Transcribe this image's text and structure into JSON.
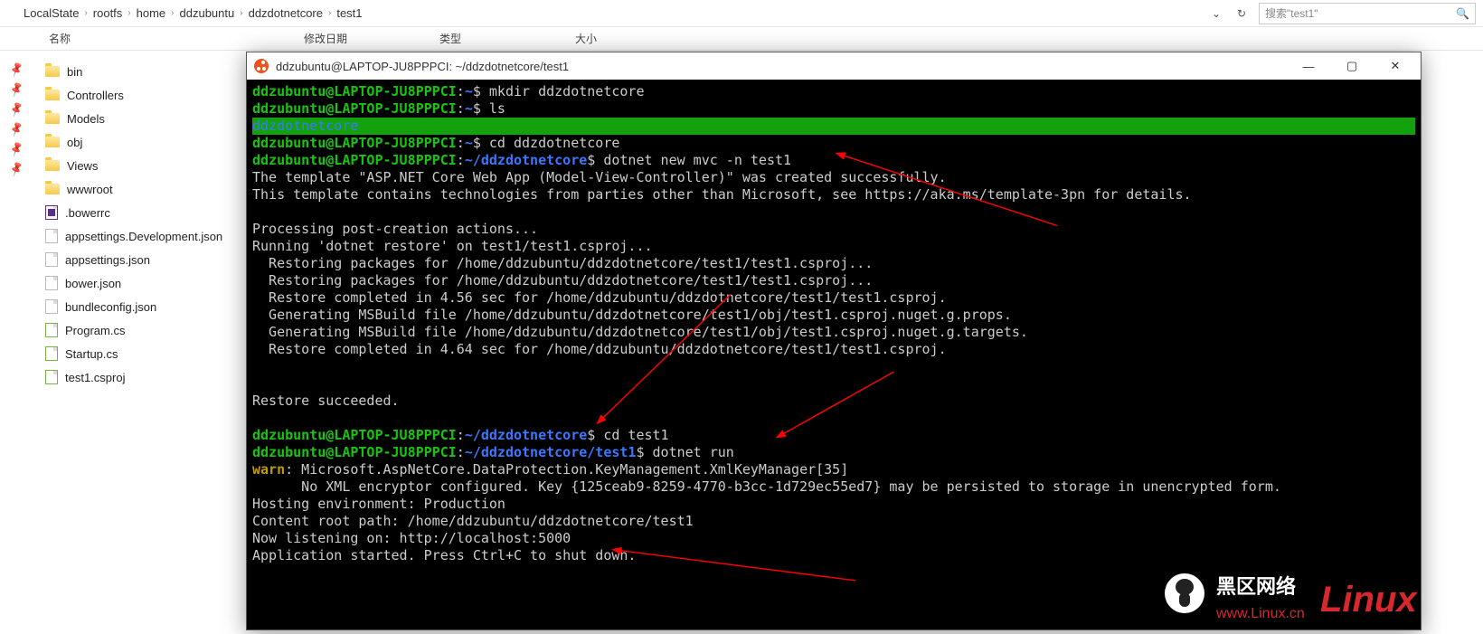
{
  "breadcrumb": [
    "LocalState",
    "rootfs",
    "home",
    "ddzubuntu",
    "ddzdotnetcore",
    "test1"
  ],
  "search_placeholder": "搜索\"test1\"",
  "columns": {
    "name": "名称",
    "mod": "修改日期",
    "type": "类型",
    "size": "大小"
  },
  "files": [
    {
      "name": "bin",
      "type": "folder"
    },
    {
      "name": "Controllers",
      "type": "folder"
    },
    {
      "name": "Models",
      "type": "folder"
    },
    {
      "name": "obj",
      "type": "folder"
    },
    {
      "name": "Views",
      "type": "folder"
    },
    {
      "name": "wwwroot",
      "type": "folder"
    },
    {
      "name": ".bowerrc",
      "type": "vs"
    },
    {
      "name": "appsettings.Development.json",
      "type": "file"
    },
    {
      "name": "appsettings.json",
      "type": "file"
    },
    {
      "name": "bower.json",
      "type": "file"
    },
    {
      "name": "bundleconfig.json",
      "type": "file"
    },
    {
      "name": "Program.cs",
      "type": "prog"
    },
    {
      "name": "Startup.cs",
      "type": "prog"
    },
    {
      "name": "test1.csproj",
      "type": "prog"
    }
  ],
  "pin_count": 6,
  "terminal": {
    "title": "ddzubuntu@LAPTOP-JU8PPPCI: ~/ddzdotnetcore/test1",
    "prompt_user": "ddzubuntu@LAPTOP-JU8PPPCI",
    "home_tilde": "~",
    "dir1": "~/ddzdotnetcore",
    "dir2": "~/ddzdotnetcore/test1",
    "cmd_mkdir": "mkdir ddzdotnetcore",
    "cmd_ls": "ls",
    "ls_out": "ddzdotnetcore",
    "cmd_cd1": "cd ddzdotnetcore",
    "cmd_new": "dotnet new mvc -n test1",
    "out_template": "The template \"ASP.NET Core Web App (Model-View-Controller)\" was created successfully.",
    "out_parties": "This template contains technologies from parties other than Microsoft, see https://aka.ms/template-3pn for details.",
    "out_post": "Processing post-creation actions...",
    "out_restore": "Running 'dotnet restore' on test1/test1.csproj...",
    "out_r1": "  Restoring packages for /home/ddzubuntu/ddzdotnetcore/test1/test1.csproj...",
    "out_r2": "  Restoring packages for /home/ddzubuntu/ddzdotnetcore/test1/test1.csproj...",
    "out_r3": "  Restore completed in 4.56 sec for /home/ddzubuntu/ddzdotnetcore/test1/test1.csproj.",
    "out_r4": "  Generating MSBuild file /home/ddzubuntu/ddzdotnetcore/test1/obj/test1.csproj.nuget.g.props.",
    "out_r5": "  Generating MSBuild file /home/ddzubuntu/ddzdotnetcore/test1/obj/test1.csproj.nuget.g.targets.",
    "out_r6": "  Restore completed in 4.64 sec for /home/ddzubuntu/ddzdotnetcore/test1/test1.csproj.",
    "out_succ": "Restore succeeded.",
    "cmd_cd2": "cd test1",
    "cmd_run": "dotnet run",
    "warn_label": "warn",
    "warn_src": ": Microsoft.AspNetCore.DataProtection.KeyManagement.XmlKeyManager[35]",
    "warn_body": "      No XML encryptor configured. Key {125ceab9-8259-4770-b3cc-1d729ec55ed7} may be persisted to storage in unencrypted form.",
    "out_env": "Hosting environment: Production",
    "out_root": "Content root path: /home/ddzubuntu/ddzdotnetcore/test1",
    "out_listen": "Now listening on: http://localhost:5000",
    "out_app": "Application started. Press Ctrl+C to shut down."
  },
  "watermark": {
    "top": "黑区网络",
    "bottom": "www.Linux.cn",
    "linux_text": "Linux"
  }
}
